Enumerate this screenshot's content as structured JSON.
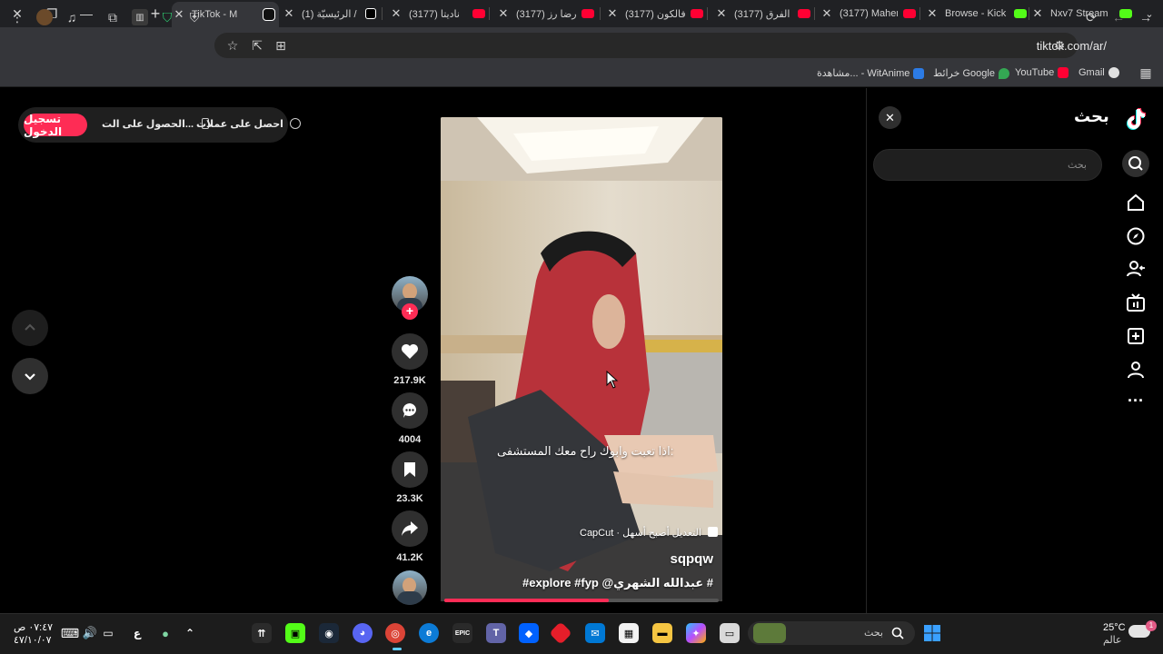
{
  "browser": {
    "tabs": [
      {
        "label": "Nxv7 Stream",
        "color": "#53fc18"
      },
      {
        "label": "Browse - Kick",
        "color": "#53fc18"
      },
      {
        "label": "(3177) Maher",
        "color": "#ff0033"
      },
      {
        "label": "(3177) الفرق",
        "color": "#ff0033"
      },
      {
        "label": "(3177) فالكون",
        "color": "#ff0033"
      },
      {
        "label": "(3177) رضا رز",
        "color": "#ff0033"
      },
      {
        "label": "(3177) ناديتا",
        "color": "#ff0033"
      },
      {
        "label": "(1) الرئيسيّة /",
        "color": "#ffffff"
      },
      {
        "label": "TikTok - M",
        "color": "#ffffff",
        "active": true
      }
    ],
    "url": "tiktok.com/ar/",
    "bookmarks": [
      {
        "label": "Gmail",
        "color": "#ffffff"
      },
      {
        "label": "YouTube",
        "color": "#ff0033"
      },
      {
        "label": "خرائط Google",
        "color": "#34a853"
      },
      {
        "label": "مشاهدة... - WitAnime",
        "color": "#2c7be5"
      }
    ]
  },
  "tiktok": {
    "search_title": "بحث",
    "search_placeholder": "بحث",
    "get_coins": "احصل على عملات",
    "get_app": "الحصول على الت...",
    "login": "تسجيل الدخول",
    "counts": {
      "likes": "217.9K",
      "comments": "4004",
      "saves": "23.3K",
      "shares": "41.2K"
    },
    "video": {
      "caption": "اذا تعبت وابوك راح معك المستشفى:",
      "capcut": "CapCut · التعديل أصبح أسهل",
      "author": "sqpqw",
      "description": "#explore #fyp @عبدالله الشهري #",
      "progress": 0.6
    }
  },
  "taskbar": {
    "weather_temp": "25°C",
    "weather_desc": "عالم",
    "search_placeholder": "بحث",
    "time": "٠٧:٤٧ ص",
    "date": "٤٧/١٠/٠٧",
    "lang": "ع"
  },
  "colors": {
    "accent": "#fe2c55",
    "tabbar": "#202124",
    "toolbar": "#35363a"
  }
}
